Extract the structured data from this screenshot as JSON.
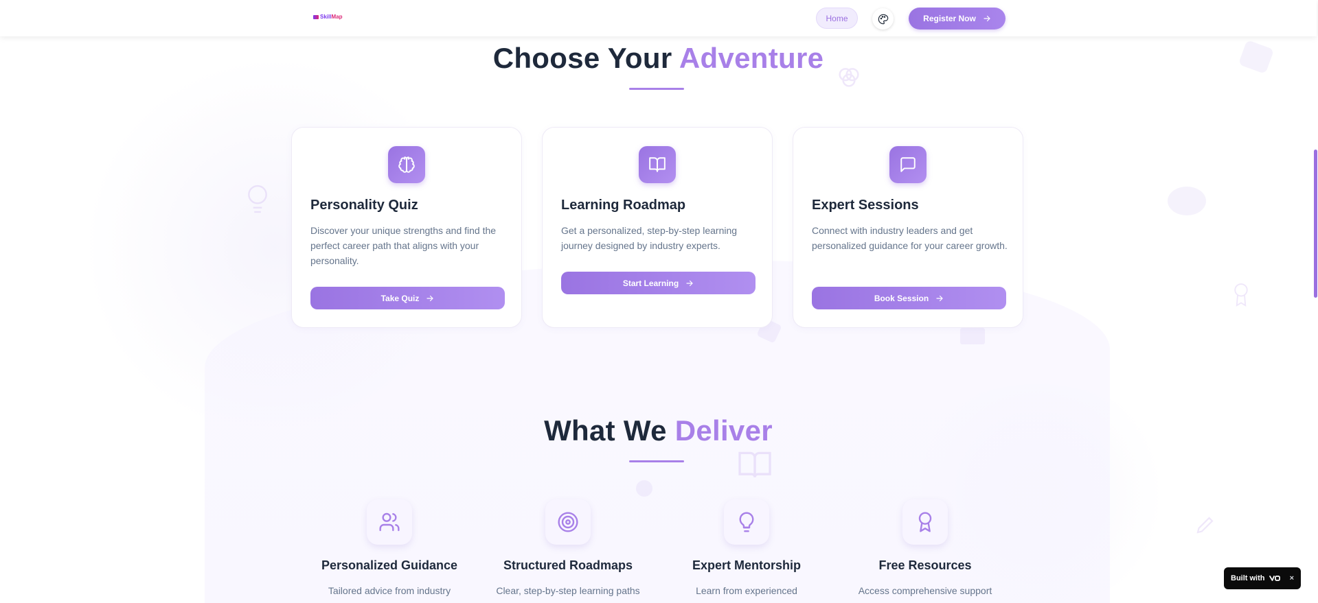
{
  "header": {
    "logo_prefix": "Skill",
    "logo_suffix": "Map",
    "nav_home": "Home",
    "register_label": "Register Now"
  },
  "adventure": {
    "title_main": "Choose Your ",
    "title_accent": "Adventure",
    "cards": [
      {
        "title": "Personality Quiz",
        "description": "Discover your unique strengths and find the perfect career path that aligns with your personality.",
        "button": "Take Quiz",
        "icon": "brain-icon"
      },
      {
        "title": "Learning Roadmap",
        "description": "Get a personalized, step-by-step learning journey designed by industry experts.",
        "button": "Start Learning",
        "icon": "open-book-icon"
      },
      {
        "title": "Expert Sessions",
        "description": "Connect with industry leaders and get personalized guidance for your career growth.",
        "button": "Book Session",
        "icon": "chat-bubble-icon"
      }
    ]
  },
  "deliver": {
    "title_main": "What We ",
    "title_accent": "Deliver",
    "features": [
      {
        "title": "Personalized Guidance",
        "description": "Tailored advice from industry",
        "icon": "users-icon"
      },
      {
        "title": "Structured Roadmaps",
        "description": "Clear, step-by-step learning paths",
        "icon": "target-icon"
      },
      {
        "title": "Expert Mentorship",
        "description": "Learn from experienced",
        "icon": "lightbulb-icon"
      },
      {
        "title": "Free Resources",
        "description": "Access comprehensive support",
        "icon": "award-icon"
      }
    ]
  },
  "badge": {
    "label": "Built with",
    "close": "×"
  },
  "colors": {
    "accent": "#a880e8",
    "heading": "#1e293b",
    "body_text": "#64748b"
  }
}
